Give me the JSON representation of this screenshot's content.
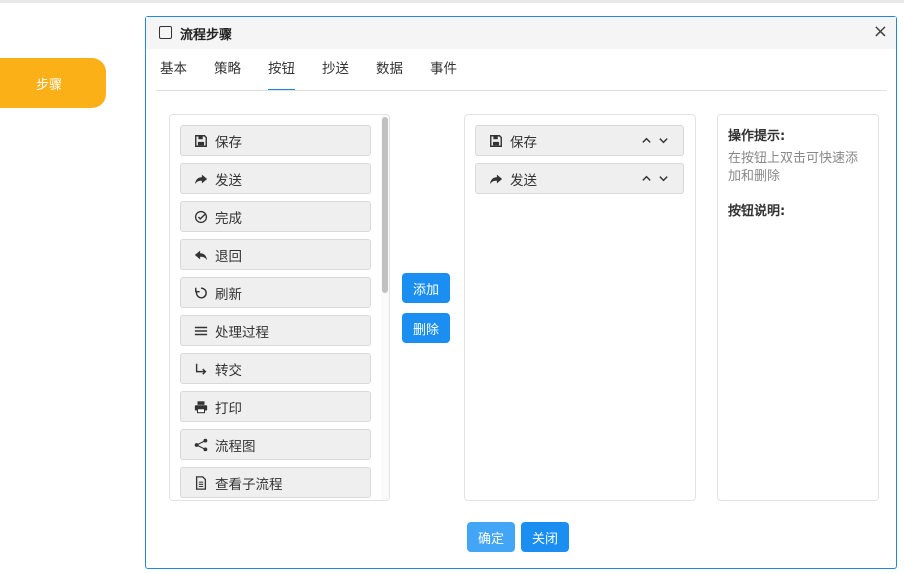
{
  "side": {
    "step_label": "步骤"
  },
  "dialog": {
    "title": "流程步骤",
    "close": "×",
    "tabs": [
      {
        "label": "基本"
      },
      {
        "label": "策略"
      },
      {
        "label": "按钮"
      },
      {
        "label": "抄送"
      },
      {
        "label": "数据"
      },
      {
        "label": "事件"
      }
    ],
    "active_tab": "按钮",
    "available_buttons": [
      {
        "label": "保存",
        "icon": "save-icon"
      },
      {
        "label": "发送",
        "icon": "share-icon"
      },
      {
        "label": "完成",
        "icon": "check-circle-icon"
      },
      {
        "label": "退回",
        "icon": "reply-icon"
      },
      {
        "label": "刷新",
        "icon": "refresh-icon"
      },
      {
        "label": "处理过程",
        "icon": "list-icon"
      },
      {
        "label": "转交",
        "icon": "turn-arrow-icon"
      },
      {
        "label": "打印",
        "icon": "print-icon"
      },
      {
        "label": "流程图",
        "icon": "share-nodes-icon"
      },
      {
        "label": "查看子流程",
        "icon": "document-icon"
      }
    ],
    "selected_buttons": [
      {
        "label": "保存",
        "icon": "save-icon"
      },
      {
        "label": "发送",
        "icon": "share-icon"
      }
    ],
    "add_label": "添加",
    "delete_label": "删除",
    "hint": {
      "op_title": "操作提示:",
      "op_text": "在按钮上双击可快速添加和删除",
      "desc_title": "按钮说明:"
    },
    "ok_label": "确定",
    "close_label": "关闭"
  },
  "colors": {
    "accent": "#1b8ef2",
    "step": "#fbb018",
    "border": "#1e88e5"
  }
}
